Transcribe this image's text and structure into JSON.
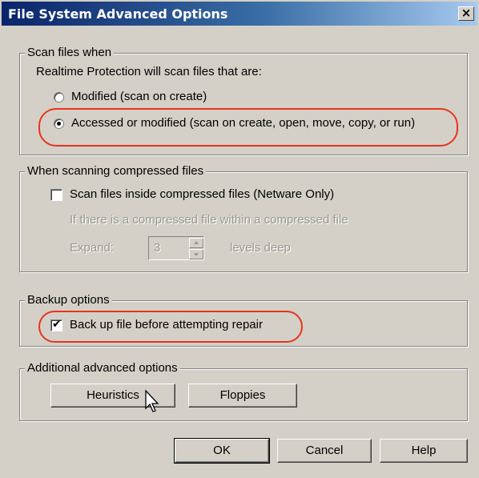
{
  "window": {
    "title": "File System Advanced Options",
    "close_label": "×"
  },
  "scan_group": {
    "legend": "Scan files when",
    "intro": "Realtime Protection will scan files that are:",
    "options": [
      {
        "label": "Modified (scan on create)",
        "selected": false
      },
      {
        "label": "Accessed or modified (scan on create, open, move, copy, or run)",
        "selected": true
      }
    ]
  },
  "compressed_group": {
    "legend": "When scanning compressed files",
    "checkbox_label": "Scan files inside compressed files (Netware Only)",
    "checked": false,
    "nested_text": "If there is a compressed file within a compressed file",
    "expand_label": "Expand:",
    "expand_value": "3",
    "levels_label": "levels deep"
  },
  "backup_group": {
    "legend": "Backup options",
    "checkbox_label": "Back up file before attempting repair",
    "checked": true
  },
  "additional_group": {
    "legend": "Additional advanced options",
    "heuristics_label": "Heuristics",
    "floppies_label": "Floppies"
  },
  "footer": {
    "ok_label": "OK",
    "cancel_label": "Cancel",
    "help_label": "Help"
  },
  "colors": {
    "highlight": "#e8341c",
    "titlebar_start": "#0a246a",
    "titlebar_end": "#a6caf0",
    "dialog_bg": "#d4d0c8"
  },
  "icons": {
    "cursor": "mouse-pointer-icon",
    "check": "checkmark-icon"
  }
}
